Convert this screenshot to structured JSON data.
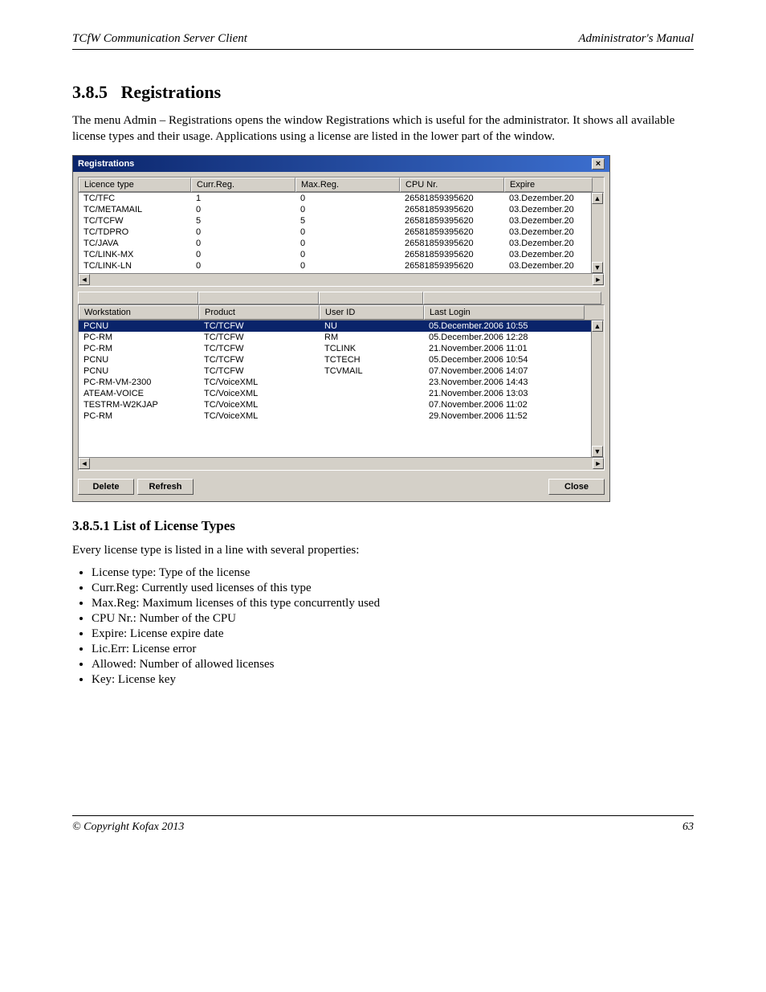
{
  "header": {
    "left": "TCfW Communication Server Client",
    "right": "Administrator's Manual"
  },
  "sections": {
    "title_num": "3.8.5",
    "title_text": "Registrations",
    "para1": "The menu Admin – Registrations opens the window Registrations which is useful for the administrator. It shows all available license types and their usage. Applications using a license are listed in the lower part of the window.",
    "sub1": "3.8.5.1  List of License Types",
    "para2": "Every license type is listed in a line with several properties:",
    "list1": [
      "License type: Type of the license",
      "Curr.Reg: Currently used licenses of this type",
      "Max.Reg: Maximum licenses of this type concurrently used",
      "CPU Nr.: Number of the CPU",
      "Expire: License expire date",
      "Lic.Err: License error",
      "Allowed: Number of allowed licenses",
      "Key: License key"
    ]
  },
  "dialog": {
    "title": "Registrations",
    "close_glyph": "×",
    "top_cols": [
      "Licence type",
      "Curr.Reg.",
      "Max.Reg.",
      "CPU Nr.",
      "Expire"
    ],
    "top_rows": [
      {
        "lt": "TC/TFC",
        "cr": "1",
        "mr": "0",
        "cpu": "26581859395620",
        "exp": "03.Dezember.20"
      },
      {
        "lt": "TC/METAMAIL",
        "cr": "0",
        "mr": "0",
        "cpu": "26581859395620",
        "exp": "03.Dezember.20"
      },
      {
        "lt": "TC/TCFW",
        "cr": "5",
        "mr": "5",
        "cpu": "26581859395620",
        "exp": "03.Dezember.20"
      },
      {
        "lt": "TC/TDPRO",
        "cr": "0",
        "mr": "0",
        "cpu": "26581859395620",
        "exp": "03.Dezember.20"
      },
      {
        "lt": "TC/JAVA",
        "cr": "0",
        "mr": "0",
        "cpu": "26581859395620",
        "exp": "03.Dezember.20"
      },
      {
        "lt": "TC/LINK-MX",
        "cr": "0",
        "mr": "0",
        "cpu": "26581859395620",
        "exp": "03.Dezember.20"
      },
      {
        "lt": "TC/LINK-LN",
        "cr": "0",
        "mr": "0",
        "cpu": "26581859395620",
        "exp": "03.Dezember.20"
      }
    ],
    "bot_cols": [
      "Workstation",
      "Product",
      "User ID",
      "Last Login"
    ],
    "bot_rows": [
      {
        "ws": "PCNU",
        "pr": "TC/TCFW",
        "uid": "NU",
        "ll": "05.December.2006   10:55",
        "sel": true
      },
      {
        "ws": "PC-RM",
        "pr": "TC/TCFW",
        "uid": "RM",
        "ll": "05.December.2006   12:28"
      },
      {
        "ws": "PC-RM",
        "pr": "TC/TCFW",
        "uid": "TCLINK",
        "ll": "21.November.2006   11:01"
      },
      {
        "ws": "PCNU",
        "pr": "TC/TCFW",
        "uid": "TCTECH",
        "ll": "05.December.2006   10:54"
      },
      {
        "ws": "PCNU",
        "pr": "TC/TCFW",
        "uid": "TCVMAIL",
        "ll": "07.November.2006   14:07"
      },
      {
        "ws": "PC-RM-VM-2300",
        "pr": "TC/VoiceXML",
        "uid": "",
        "ll": "23.November.2006   14:43"
      },
      {
        "ws": "ATEAM-VOICE",
        "pr": "TC/VoiceXML",
        "uid": "",
        "ll": "21.November.2006   13:03"
      },
      {
        "ws": "TESTRM-W2KJAP",
        "pr": "TC/VoiceXML",
        "uid": "",
        "ll": "07.November.2006   11:02"
      },
      {
        "ws": "PC-RM",
        "pr": "TC/VoiceXML",
        "uid": "",
        "ll": "29.November.2006   11:52"
      }
    ],
    "buttons": {
      "delete": "Delete",
      "refresh": "Refresh",
      "close": "Close"
    },
    "arrows": {
      "up": "▲",
      "down": "▼",
      "left": "◄",
      "right": "►"
    }
  },
  "footer": {
    "left": "© Copyright Kofax 2013",
    "right": "63"
  }
}
